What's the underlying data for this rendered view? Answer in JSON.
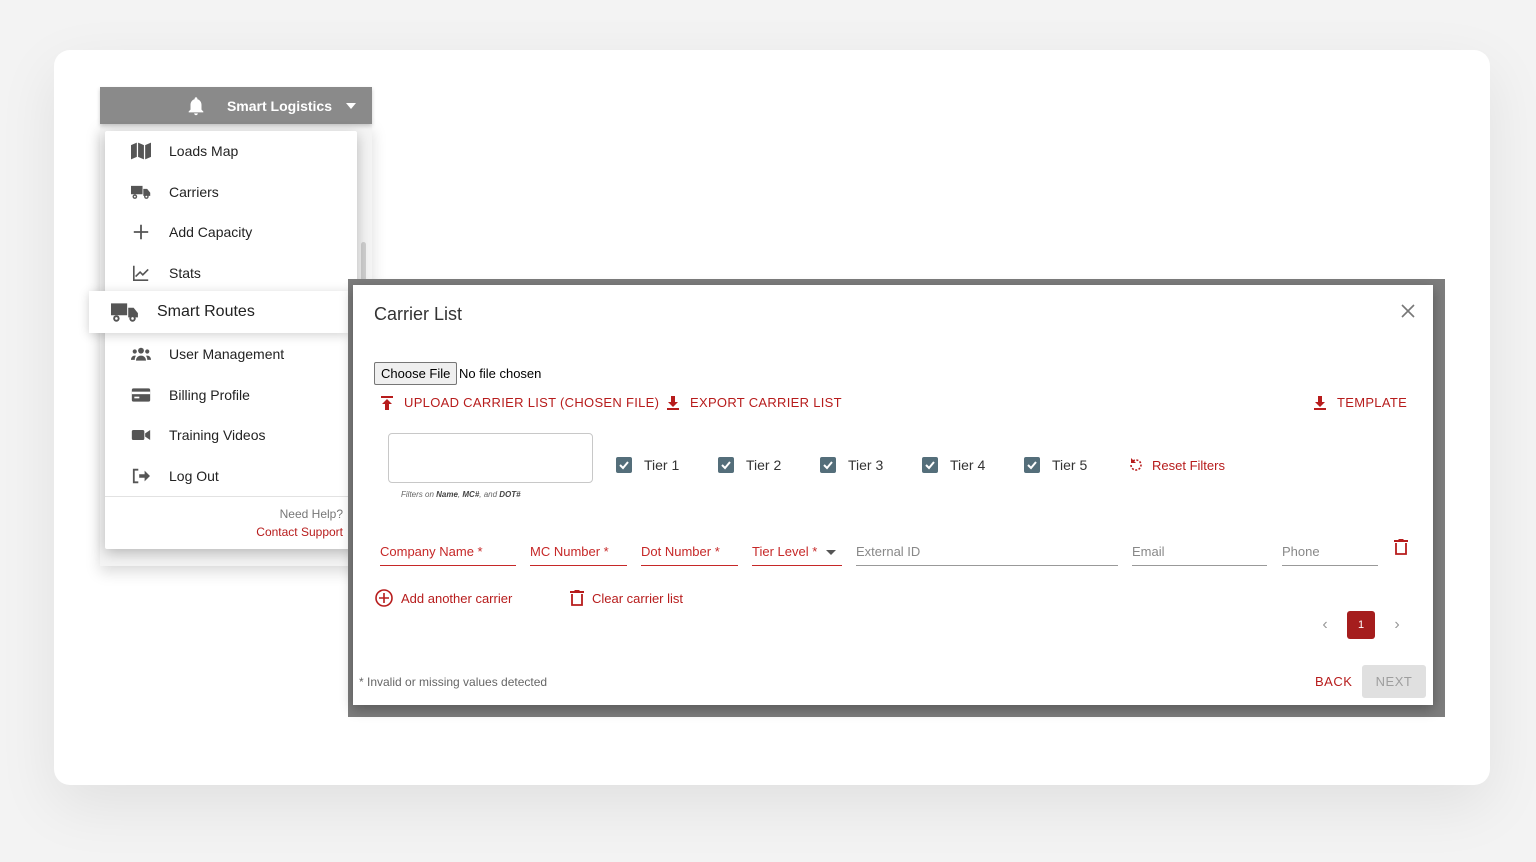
{
  "appbar": {
    "org_name": "Smart Logistics"
  },
  "menu": {
    "items": [
      {
        "label": "Loads Map",
        "icon": "map-icon"
      },
      {
        "label": "Carriers",
        "icon": "truck-icon"
      },
      {
        "label": "Add Capacity",
        "icon": "plus-icon"
      },
      {
        "label": "Stats",
        "icon": "line-chart-icon"
      },
      {
        "label": "Smart Routes",
        "icon": "truck-icon"
      },
      {
        "label": "User Management",
        "icon": "users-icon"
      },
      {
        "label": "Billing Profile",
        "icon": "credit-card-icon"
      },
      {
        "label": "Training Videos",
        "icon": "video-camera-icon"
      },
      {
        "label": "Log Out",
        "icon": "logout-icon"
      }
    ],
    "need_help": "Need Help?",
    "contact_support": "Contact Support"
  },
  "modal": {
    "title": "Carrier List",
    "file_button": "Choose File",
    "file_status": "No file chosen",
    "upload_label": "UPLOAD CARRIER LIST (CHOSEN FILE)",
    "export_label": "EXPORT CARRIER LIST",
    "template_label": "TEMPLATE",
    "search_value": "",
    "search_hint_prefix": "Filters on ",
    "search_hint_name": "Name",
    "search_hint_sep1": ", ",
    "search_hint_mc": "MC#",
    "search_hint_sep2": ", and ",
    "search_hint_dot": "DOT#",
    "tiers": [
      {
        "label": "Tier 1",
        "checked": true
      },
      {
        "label": "Tier 2",
        "checked": true
      },
      {
        "label": "Tier 3",
        "checked": true
      },
      {
        "label": "Tier 4",
        "checked": true
      },
      {
        "label": "Tier 5",
        "checked": true
      }
    ],
    "reset_filters": "Reset Filters",
    "fields": {
      "company_name": "Company Name *",
      "mc_number": "MC Number *",
      "dot_number": "Dot Number *",
      "tier_level": "Tier Level *",
      "external_id": "External ID",
      "email": "Email",
      "phone": "Phone"
    },
    "add_carrier": "Add another carrier",
    "clear_list": "Clear carrier list",
    "current_page": "1",
    "invalid_note": "* Invalid or missing values detected",
    "back": "BACK",
    "next": "NEXT"
  },
  "colors": {
    "accent": "#b71c1c",
    "appbar": "#8a8a8a",
    "checkbox": "#546e7a",
    "page_active": "#a51d1d"
  }
}
